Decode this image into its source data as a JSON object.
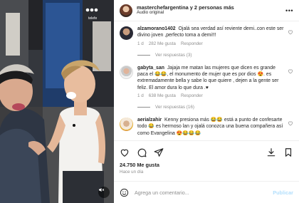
{
  "header": {
    "username": "masterchefargentina y 2 personas más",
    "subtitle": "Audio original"
  },
  "media": {
    "sign_text": "telefe"
  },
  "comments": [
    {
      "username": "alzamorano1402",
      "text": "Ojalá sea verdad así reviente demi..con este ser divino joven ,perfecto toma a demi!!!",
      "time": "1 d",
      "likes": "282 Me gusta",
      "reply": "Responder",
      "view_replies": "Ver respuestas (3)"
    },
    {
      "username": "gabyta_san",
      "text": "Jajaja me matan las mujeres que dicen es grande paca el 😂😂, el monumento de mujer que es por dios 😍. es extremadamente bella y sabe lo que quiere , dejen a la gente ser feliz. El amor dura lo que dura .♥",
      "time": "1 d",
      "likes": "638 Me gusta",
      "reply": "Responder",
      "view_replies": "Ver respuestas (16)"
    },
    {
      "username": "aerialzahir",
      "text": "Kenny presiona más 😂😂 está a punto de confesarte todo 😂 es hermoso lan y ojalá conozca una buena compañera así como Evangelina 😍😂😂😂",
      "time": "",
      "likes": "",
      "reply": "",
      "view_replies": ""
    }
  ],
  "actions": {
    "likes_count": "24.750 Me gusta",
    "time_ago": "Hace un día"
  },
  "add_comment": {
    "placeholder": "Agrega un comentario...",
    "publish_label": "Publicar"
  },
  "colors": {
    "publish_disabled": "#b2dffc",
    "like_red": "#ed4956",
    "muted_text": "#8e8e8e"
  }
}
